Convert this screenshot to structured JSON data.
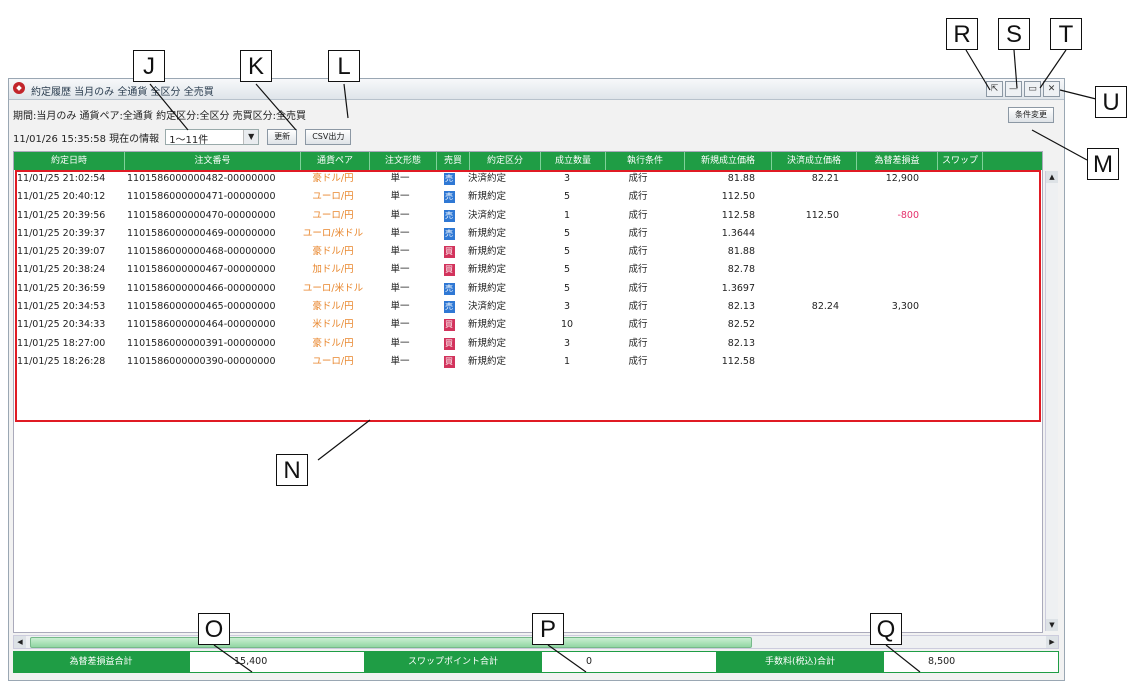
{
  "window": {
    "title": "約定履歴 当月のみ 全通貨 全区分 全売買",
    "controls": [
      "⇱",
      "—",
      "▭",
      "✕"
    ]
  },
  "filter_line": "期間:当月のみ 通貨ペア:全通貨 約定区分:全区分 売買区分:全売買",
  "time_label": "11/01/26 15:35:58 現在の情報",
  "range_value": "1～11件",
  "buttons": {
    "update": "更新",
    "csv": "CSV出力",
    "condition": "条件変更"
  },
  "columns": [
    "約定日時",
    "注文番号",
    "通貨ペア",
    "注文形態",
    "売買",
    "約定区分",
    "成立数量",
    "執行条件",
    "新規成立価格",
    "決済成立価格",
    "為替差損益",
    "スワップ"
  ],
  "rows": [
    {
      "date": "11/01/25 21:02:54",
      "order": "1101586000000482-00000000",
      "pair": "豪ドル/円",
      "type": "単一",
      "side": "売",
      "side_kind": "sell",
      "category": "決済約定",
      "qty": "3",
      "cond": "成行",
      "open": "81.88",
      "close": "82.21",
      "pl": "12,900",
      "pl_neg": false
    },
    {
      "date": "11/01/25 20:40:12",
      "order": "1101586000000471-00000000",
      "pair": "ユーロ/円",
      "type": "単一",
      "side": "売",
      "side_kind": "sell",
      "category": "新規約定",
      "qty": "5",
      "cond": "成行",
      "open": "112.50",
      "close": "",
      "pl": "",
      "pl_neg": false
    },
    {
      "date": "11/01/25 20:39:56",
      "order": "1101586000000470-00000000",
      "pair": "ユーロ/円",
      "type": "単一",
      "side": "売",
      "side_kind": "sell",
      "category": "決済約定",
      "qty": "1",
      "cond": "成行",
      "open": "112.58",
      "close": "112.50",
      "pl": "-800",
      "pl_neg": true
    },
    {
      "date": "11/01/25 20:39:37",
      "order": "1101586000000469-00000000",
      "pair": "ユーロ/米ドル",
      "type": "単一",
      "side": "売",
      "side_kind": "sell",
      "category": "新規約定",
      "qty": "5",
      "cond": "成行",
      "open": "1.3644",
      "close": "",
      "pl": "",
      "pl_neg": false
    },
    {
      "date": "11/01/25 20:39:07",
      "order": "1101586000000468-00000000",
      "pair": "豪ドル/円",
      "type": "単一",
      "side": "買",
      "side_kind": "buy",
      "category": "新規約定",
      "qty": "5",
      "cond": "成行",
      "open": "81.88",
      "close": "",
      "pl": "",
      "pl_neg": false
    },
    {
      "date": "11/01/25 20:38:24",
      "order": "1101586000000467-00000000",
      "pair": "加ドル/円",
      "type": "単一",
      "side": "買",
      "side_kind": "buy",
      "category": "新規約定",
      "qty": "5",
      "cond": "成行",
      "open": "82.78",
      "close": "",
      "pl": "",
      "pl_neg": false
    },
    {
      "date": "11/01/25 20:36:59",
      "order": "1101586000000466-00000000",
      "pair": "ユーロ/米ドル",
      "type": "単一",
      "side": "売",
      "side_kind": "sell",
      "category": "新規約定",
      "qty": "5",
      "cond": "成行",
      "open": "1.3697",
      "close": "",
      "pl": "",
      "pl_neg": false
    },
    {
      "date": "11/01/25 20:34:53",
      "order": "1101586000000465-00000000",
      "pair": "豪ドル/円",
      "type": "単一",
      "side": "売",
      "side_kind": "sell",
      "category": "決済約定",
      "qty": "3",
      "cond": "成行",
      "open": "82.13",
      "close": "82.24",
      "pl": "3,300",
      "pl_neg": false
    },
    {
      "date": "11/01/25 20:34:33",
      "order": "1101586000000464-00000000",
      "pair": "米ドル/円",
      "type": "単一",
      "side": "買",
      "side_kind": "buy",
      "category": "新規約定",
      "qty": "10",
      "cond": "成行",
      "open": "82.52",
      "close": "",
      "pl": "",
      "pl_neg": false
    },
    {
      "date": "11/01/25 18:27:00",
      "order": "1101586000000391-00000000",
      "pair": "豪ドル/円",
      "type": "単一",
      "side": "買",
      "side_kind": "buy",
      "category": "新規約定",
      "qty": "3",
      "cond": "成行",
      "open": "82.13",
      "close": "",
      "pl": "",
      "pl_neg": false
    },
    {
      "date": "11/01/25 18:26:28",
      "order": "1101586000000390-00000000",
      "pair": "ユーロ/円",
      "type": "単一",
      "side": "買",
      "side_kind": "buy",
      "category": "新規約定",
      "qty": "1",
      "cond": "成行",
      "open": "112.58",
      "close": "",
      "pl": "",
      "pl_neg": false
    }
  ],
  "totals": {
    "pl_label": "為替差損益合計",
    "pl_value": "15,400",
    "swap_label": "スワップポイント合計",
    "swap_value": "0",
    "fee_label": "手数料(税込)合計",
    "fee_value": "8,500"
  },
  "callouts": [
    "J",
    "K",
    "L",
    "M",
    "N",
    "O",
    "P",
    "Q",
    "R",
    "S",
    "T",
    "U"
  ],
  "colors": {
    "header_green": "#1f9d45",
    "pair_orange": "#e8862c",
    "sell_blue": "#2f78d4",
    "buy_red": "#d2335c",
    "highlight_red": "#e01b24"
  }
}
